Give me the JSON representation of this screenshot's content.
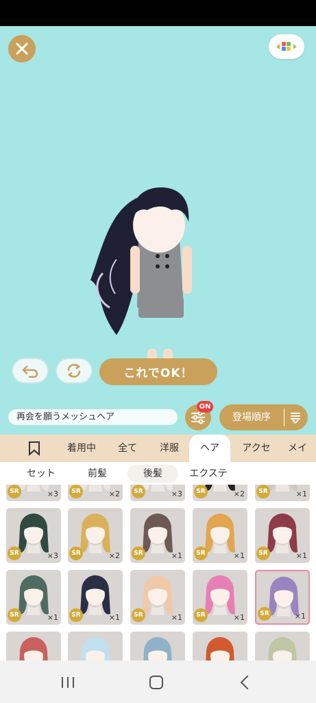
{
  "top_bar": {
    "close_icon": "close-icon",
    "palette_icon": "palette-icon"
  },
  "actions": {
    "undo_icon": "undo-icon",
    "random_icon": "refresh-icon",
    "confirm_label": "これでOK！"
  },
  "controls": {
    "item_name": "再会を願うメッシュヘア",
    "filter_badge": "ON",
    "sort_label": "登場順序"
  },
  "tabs": [
    {
      "label": ""
    },
    {
      "label": "着用中"
    },
    {
      "label": "全て"
    },
    {
      "label": "洋服"
    },
    {
      "label": "ヘア"
    },
    {
      "label": "アクセ"
    },
    {
      "label": "メイク"
    }
  ],
  "subtabs": [
    {
      "label": "セット"
    },
    {
      "label": "前髪"
    },
    {
      "label": "後髪"
    },
    {
      "label": "エクステ"
    }
  ],
  "items": [
    {
      "rarity": "SR",
      "qty": "×3",
      "hair": "#e8e4e0"
    },
    {
      "rarity": "SR",
      "qty": "×2",
      "hair": "#e9e6e2"
    },
    {
      "rarity": "SR",
      "qty": "×3",
      "hair": "#ece9e5"
    },
    {
      "rarity": "SR",
      "qty": "×2",
      "hair": "#222222"
    },
    {
      "rarity": "SR",
      "qty": "×1",
      "hair": "#cfc7bf"
    },
    {
      "rarity": "SR",
      "qty": "×3",
      "hair": "#2f4a40"
    },
    {
      "rarity": "SR",
      "qty": "×2",
      "hair": "#d9b15a"
    },
    {
      "rarity": "SR",
      "qty": "×1",
      "hair": "#6e5a55"
    },
    {
      "rarity": "SR",
      "qty": "×1",
      "hair": "#e2a651"
    },
    {
      "rarity": "SR",
      "qty": "×1",
      "hair": "#8e3b4a"
    },
    {
      "rarity": "SR",
      "qty": "×1",
      "hair": "#4f6b62"
    },
    {
      "rarity": "SR",
      "qty": "×1",
      "hair": "#2a2f44"
    },
    {
      "rarity": "SR",
      "qty": "×1",
      "hair": "#f0c9a9"
    },
    {
      "rarity": "SR",
      "qty": "×1",
      "hair": "#e77fb4"
    },
    {
      "rarity": "SR",
      "qty": "×1",
      "hair": "#9a84c0"
    },
    {
      "rarity": "",
      "qty": "",
      "hair": "#c9615e"
    },
    {
      "rarity": "",
      "qty": "",
      "hair": "#bfe0f0"
    },
    {
      "rarity": "",
      "qty": "",
      "hair": "#8fb2c9"
    },
    {
      "rarity": "",
      "qty": "",
      "hair": "#d35a2e"
    },
    {
      "rarity": "",
      "qty": "",
      "hair": "#bfc7a4"
    }
  ],
  "selected_item_index": 14,
  "colors": {
    "accent": "#c9a15a",
    "stage_bg": "#a6e6e4",
    "badge_red": "#e8413e",
    "selected_border": "#e98ba1"
  },
  "navbar": {
    "recent_icon": "recent-apps-icon",
    "home_icon": "home-icon",
    "back_icon": "back-icon"
  }
}
